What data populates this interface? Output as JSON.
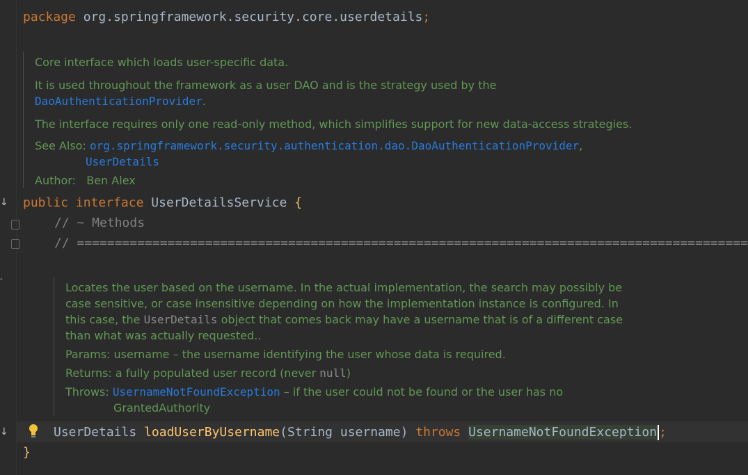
{
  "code": {
    "package_kw": "package",
    "package_name": "org.springframework.security.core.userdetails",
    "semicolon": ";",
    "public_kw": "public",
    "interface_kw": "interface",
    "interface_name": "UserDetailsService",
    "open_brace": "{",
    "close_brace": "}",
    "comment1": "// ~ Methods",
    "comment2": "// =========================================================================================================",
    "method_return": "UserDetails",
    "method_name": "loadUserByUsername",
    "paren_open": "(",
    "param_type": "String",
    "param_name": "username",
    "paren_close": ")",
    "throws_kw": "throws",
    "exception": "UsernameNotFoundException"
  },
  "doc1": {
    "line1": "Core interface which loads user-specific data.",
    "line2a": "It is used throughout the framework as a user DAO and is the strategy used by the",
    "line2b": "DaoAuthenticationProvider",
    "line2c": ".",
    "line3": "The interface requires only one read-only method, which simplifies support for new data-access strategies.",
    "see_also_label": "See Also:",
    "see_also_1": "org.springframework.security.authentication.dao.DaoAuthenticationProvider",
    "see_also_comma": ",",
    "see_also_2": "UserDetails",
    "author_label": "Author:",
    "author": "Ben Alex"
  },
  "doc2": {
    "l1": "Locates the user based on the username. In the actual implementation, the search may possibly be",
    "l2": "case sensitive, or case insensitive depending on how the implementation instance is configured. In",
    "l3a": "this case, the ",
    "l3b": "UserDetails",
    "l3c": " object that comes back may have a username that is of a different case",
    "l4": "than what was actually requested..",
    "params_label": "Params:",
    "params": "username – the username identifying the user whose data is required.",
    "returns_label": "Returns:",
    "returns_a": "a fully populated user record (never ",
    "returns_b": "null",
    "returns_c": ")",
    "throws_label": "Throws:",
    "throws_ex": "UsernameNotFoundException",
    "throws_a": " – if the user could not be found or the user has no",
    "throws_b": "GrantedAuthority"
  },
  "icons": {
    "implemented": "implemented-arrow-icon",
    "fold": "fold-marker-icon",
    "bulb": "lightbulb-icon"
  },
  "colors": {
    "background": "#2b2b2b",
    "keyword": "#cc7832",
    "doc_text": "#629755",
    "link": "#287bde",
    "function": "#ffc66d"
  }
}
